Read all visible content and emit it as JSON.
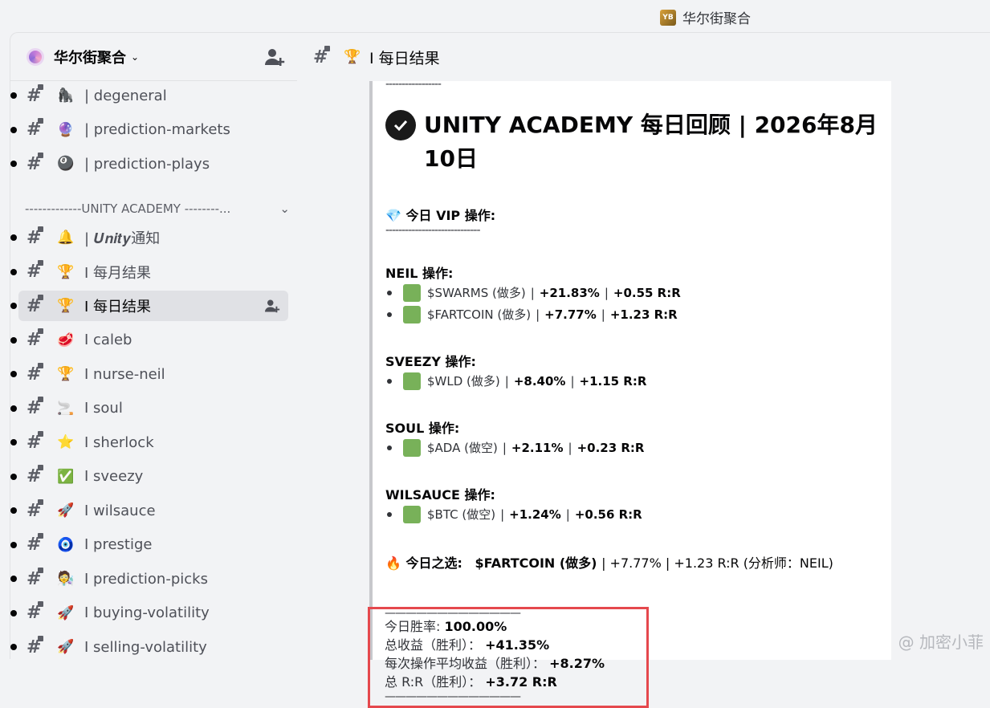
{
  "app": {
    "title": "华尔街聚合",
    "logo_text": "YB"
  },
  "server": {
    "name": "华尔街聚合",
    "chevron": "⌄"
  },
  "channels_top": [
    {
      "emoji": "🦍",
      "label": "| degeneral"
    },
    {
      "emoji": "🔮",
      "label": "| prediction-markets"
    },
    {
      "emoji": "🎱",
      "label": "| prediction-plays"
    }
  ],
  "category": {
    "label": "-------------UNITY ACADEMY --------...",
    "chevron": "⌄"
  },
  "channels": [
    {
      "emoji": "🔔",
      "label": "| 𝑼𝒏𝒊𝒕𝒚通知"
    },
    {
      "emoji": "🏆",
      "label": "I 每月结果"
    },
    {
      "emoji": "🏆",
      "label": "I 每日结果",
      "active": true
    },
    {
      "emoji": "🥩",
      "label": "I caleb"
    },
    {
      "emoji": "🏆",
      "label": "I nurse-neil"
    },
    {
      "emoji": "🚬",
      "label": "I soul"
    },
    {
      "emoji": "⭐",
      "label": "I sherlock"
    },
    {
      "emoji": "✅",
      "label": "I sveezy"
    },
    {
      "emoji": "🚀",
      "label": "I wilsauce"
    },
    {
      "emoji": "🧿",
      "label": "I prestige"
    },
    {
      "emoji": "🧑‍🔬",
      "label": "I prediction-picks"
    },
    {
      "emoji": "🚀",
      "label": "I buying-volatility"
    },
    {
      "emoji": "🚀",
      "label": "I selling-volatility"
    }
  ],
  "channel_header": {
    "emoji": "🏆",
    "title": "I 每日结果"
  },
  "message": {
    "top_dashes": "-----------------",
    "heading": "UNITY ACADEMY 每日回顾 | 2026年8月10日",
    "vip_title": "今日 VIP 操作:",
    "vip_emoji": "💎",
    "vip_dashes": "-----------------------------",
    "groups": [
      {
        "title": "NEIL 操作:",
        "trades": [
          {
            "asset": "$SWARMS (做多)",
            "pct": "+21.83%",
            "rr": "+0.55 R:R"
          },
          {
            "asset": "$FARTCOIN (做多)",
            "pct": "+7.77%",
            "rr": "+1.23 R:R"
          }
        ]
      },
      {
        "title": "SVEEZY 操作:",
        "trades": [
          {
            "asset": "$WLD (做多)",
            "pct": "+8.40%",
            "rr": "+1.15 R:R"
          }
        ]
      },
      {
        "title": "SOUL 操作:",
        "trades": [
          {
            "asset": "$ADA (做空)",
            "pct": "+2.11%",
            "rr": "+0.23 R:R"
          }
        ]
      },
      {
        "title": "WILSAUCE 操作:",
        "trades": [
          {
            "asset": "$BTC (做空)",
            "pct": "+1.24%",
            "rr": "+0.56 R:R"
          }
        ]
      }
    ],
    "pick_emoji": "🔥",
    "pick_label": "今日之选:",
    "pick_asset": "$FARTCOIN (做多)",
    "pick_detail": "| +7.77% | +1.23 R:R (分析师：NEIL)",
    "stats_dashes": "—————————————",
    "stats": [
      {
        "label": "今日胜率:",
        "value": "100.00%"
      },
      {
        "label": "总收益（胜利）：",
        "value": "+41.35%"
      },
      {
        "label": "每次操作平均收益（胜利）：",
        "value": "+8.27%"
      },
      {
        "label": "总 R:R（胜利）：",
        "value": "+3.72 R:R"
      }
    ],
    "end_dashes": "—————————————"
  },
  "watermark": "@ 加密小菲",
  "colors": {
    "accent_green": "#78b159",
    "highlight_red": "#e5484d"
  }
}
